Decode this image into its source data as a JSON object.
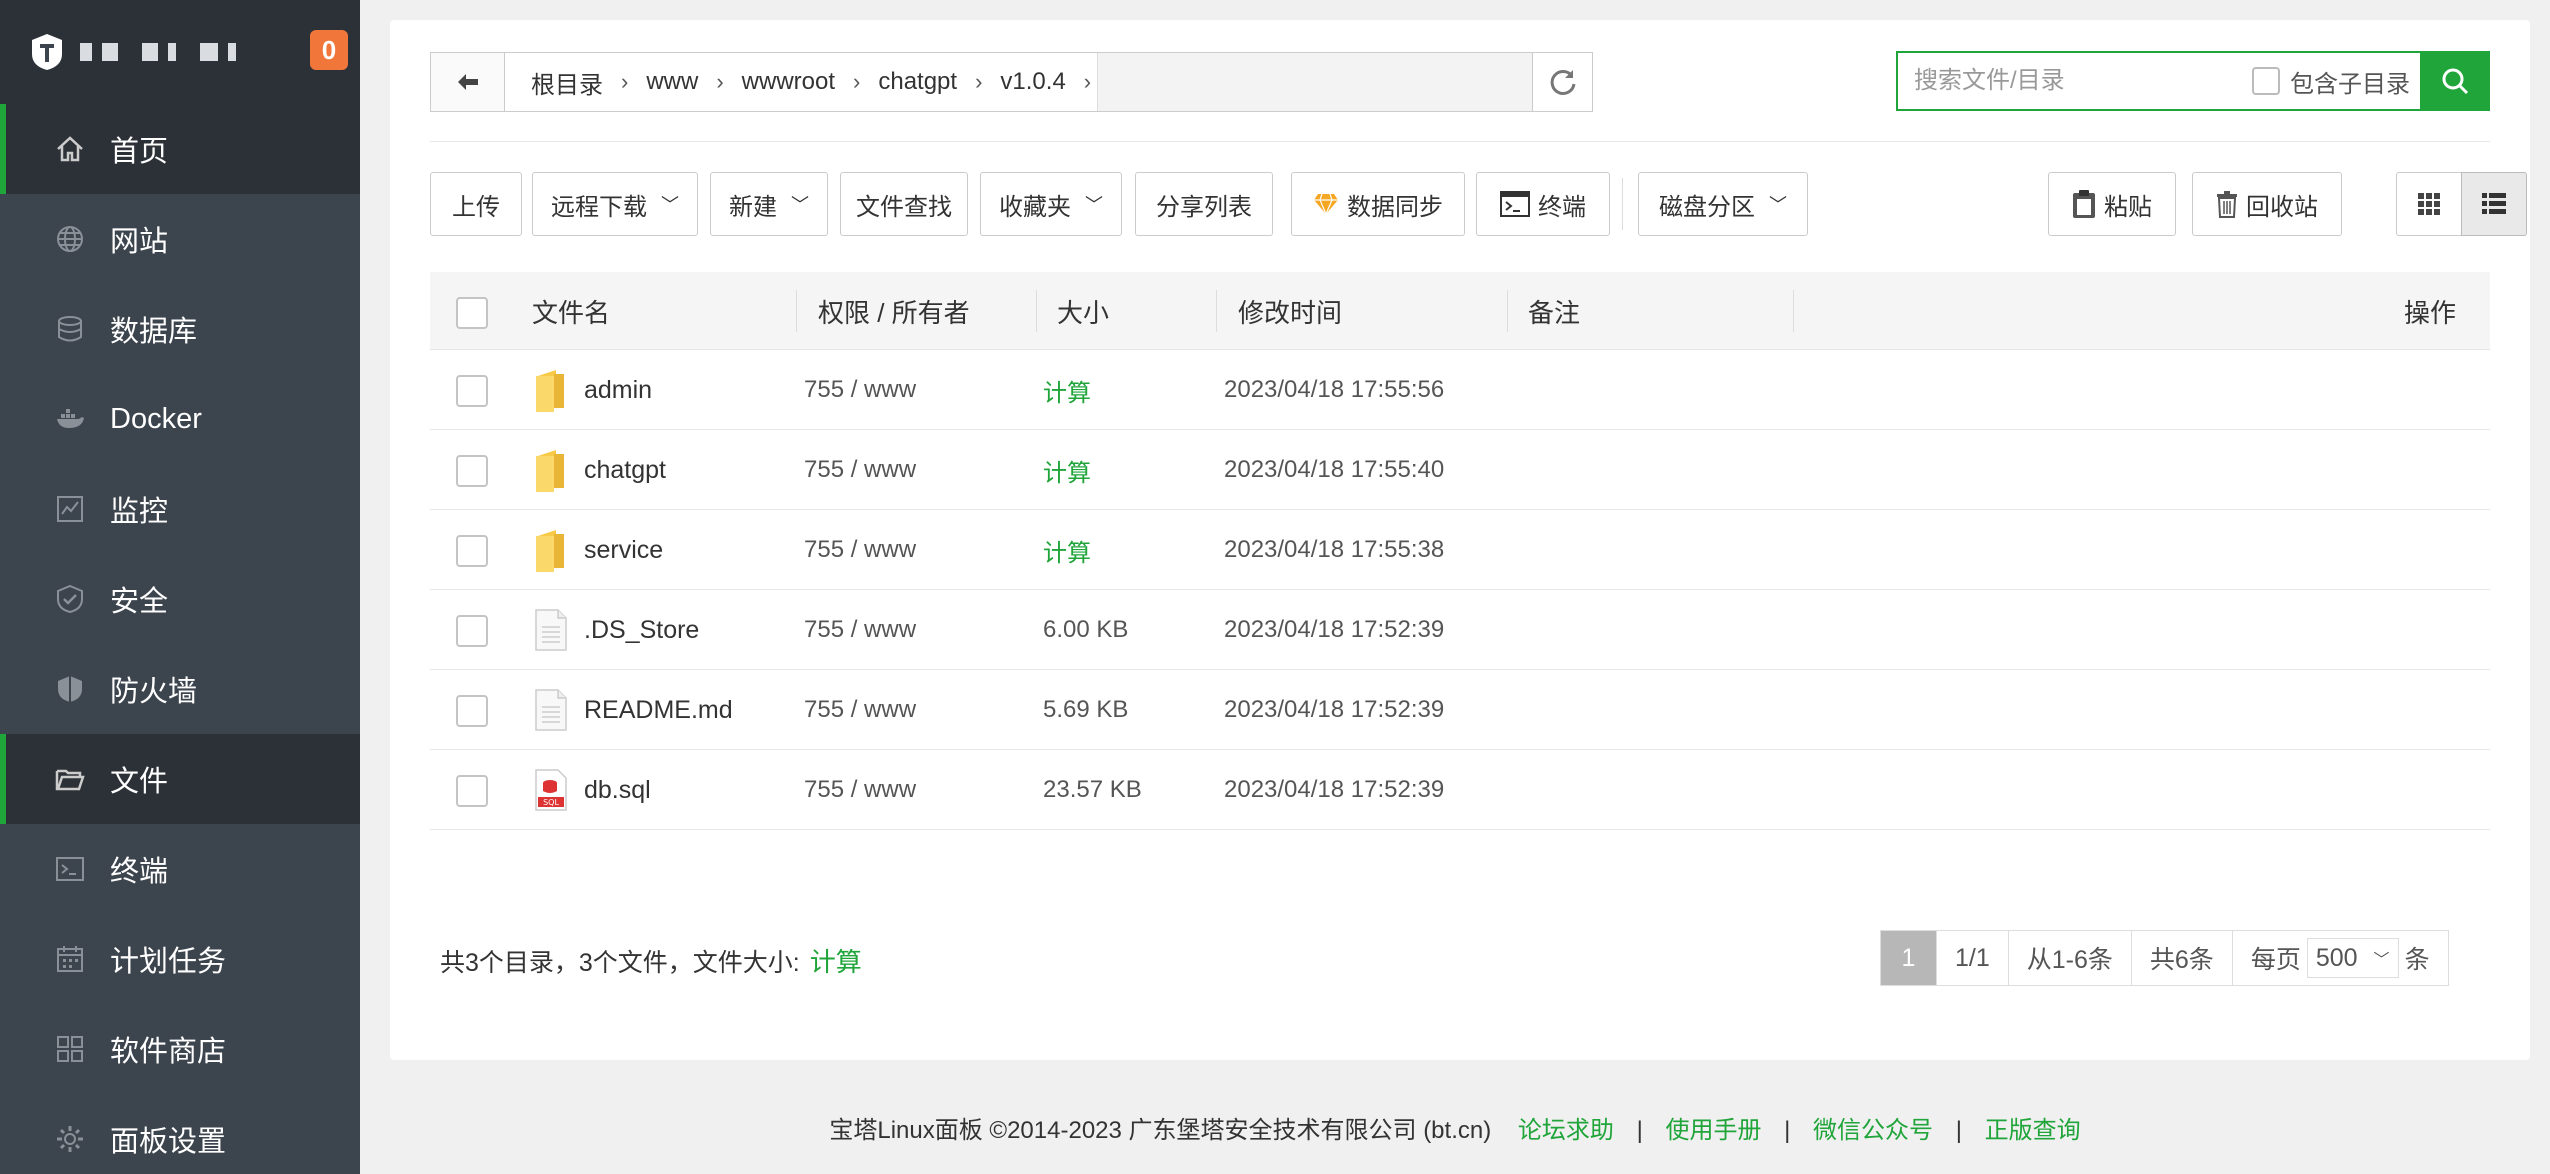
{
  "sidebar": {
    "badge": "0",
    "items": [
      {
        "label": "首页",
        "icon": "home-icon"
      },
      {
        "label": "网站",
        "icon": "globe-icon"
      },
      {
        "label": "数据库",
        "icon": "database-icon"
      },
      {
        "label": "Docker",
        "icon": "docker-icon"
      },
      {
        "label": "监控",
        "icon": "monitor-icon"
      },
      {
        "label": "安全",
        "icon": "shield-check-icon"
      },
      {
        "label": "防火墙",
        "icon": "shield-icon"
      },
      {
        "label": "文件",
        "icon": "folder-open-icon"
      },
      {
        "label": "终端",
        "icon": "terminal-icon"
      },
      {
        "label": "计划任务",
        "icon": "calendar-icon"
      },
      {
        "label": "软件商店",
        "icon": "apps-icon"
      },
      {
        "label": "面板设置",
        "icon": "gear-icon"
      }
    ]
  },
  "breadcrumb": [
    "根目录",
    "www",
    "wwwroot",
    "chatgpt",
    "v1.0.4"
  ],
  "search": {
    "placeholder": "搜索文件/目录",
    "include_sub": "包含子目录"
  },
  "toolbar": {
    "upload": "上传",
    "remote_download": "远程下载",
    "new": "新建",
    "find": "文件查找",
    "favorites": "收藏夹",
    "share_list": "分享列表",
    "data_sync": "数据同步",
    "terminal": "终端",
    "disk_partition": "磁盘分区",
    "paste": "粘贴",
    "recycle": "回收站"
  },
  "table": {
    "headers": {
      "name": "文件名",
      "perm": "权限 / 所有者",
      "size": "大小",
      "mtime": "修改时间",
      "note": "备注",
      "action": "操作"
    },
    "rows": [
      {
        "name": "admin",
        "type": "folder",
        "perm": "755 / www",
        "size": "计算",
        "mtime": "2023/04/18 17:55:56"
      },
      {
        "name": "chatgpt",
        "type": "folder",
        "perm": "755 / www",
        "size": "计算",
        "mtime": "2023/04/18 17:55:40"
      },
      {
        "name": "service",
        "type": "folder",
        "perm": "755 / www",
        "size": "计算",
        "mtime": "2023/04/18 17:55:38"
      },
      {
        "name": ".DS_Store",
        "type": "file",
        "perm": "755 / www",
        "size": "6.00 KB",
        "mtime": "2023/04/18 17:52:39"
      },
      {
        "name": "README.md",
        "type": "file",
        "perm": "755 / www",
        "size": "5.69 KB",
        "mtime": "2023/04/18 17:52:39"
      },
      {
        "name": "db.sql",
        "type": "sql",
        "perm": "755 / www",
        "size": "23.57 KB",
        "mtime": "2023/04/18 17:52:39"
      }
    ]
  },
  "summary": {
    "text": "共3个目录，3个文件，文件大小:",
    "calc": "计算"
  },
  "pager": {
    "current": "1",
    "pages": "1/1",
    "range": "从1-6条",
    "total": "共6条",
    "per_page_label": "每页",
    "per_page": "500",
    "unit": "条"
  },
  "footer": {
    "copyright": "宝塔Linux面板 ©2014-2023 广东堡塔安全技术有限公司 (bt.cn)",
    "links": [
      "论坛求助",
      "使用手册",
      "微信公众号",
      "正版查询"
    ]
  },
  "colors": {
    "accent": "#20a53a",
    "sidebar": "#3c444d",
    "sidebar_dark": "#2c3138",
    "badge": "#f0763a"
  }
}
